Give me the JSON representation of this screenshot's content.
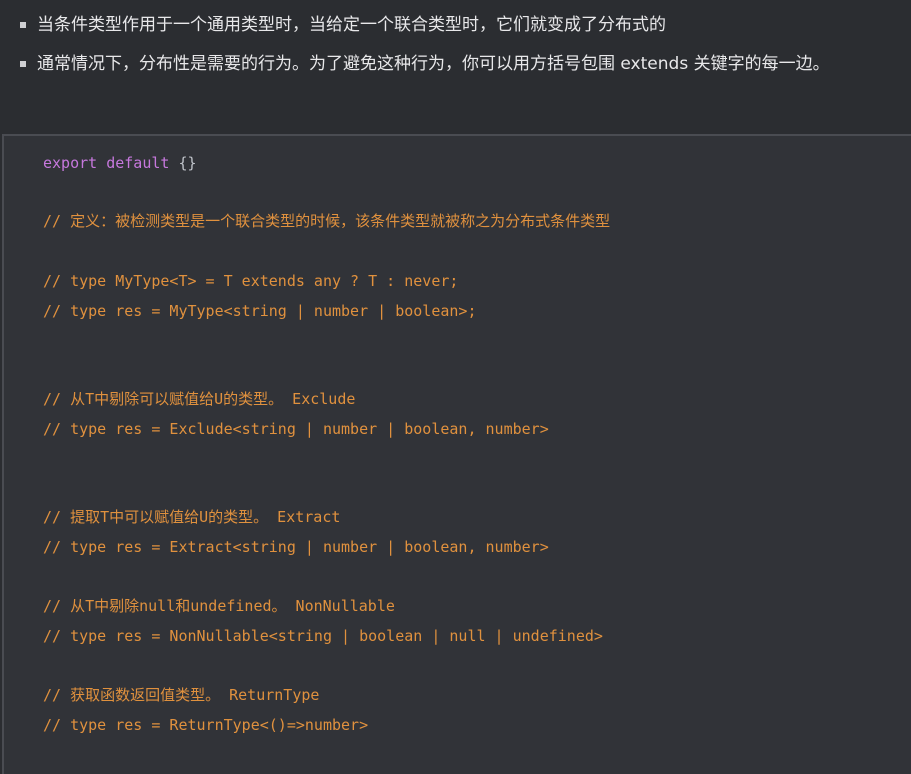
{
  "bullets": [
    {
      "text": "当条件类型作用于一个通用类型时，当给定一个联合类型时，它们就变成了分布式的"
    },
    {
      "text": "通常情况下，分布性是需要的行为。为了避免这种行为，你可以用方括号包围 extends 关键字的每一边。"
    }
  ],
  "code": {
    "export_keyword": "export default",
    "export_rest": " {}",
    "comments": [
      "// 定义：被检测类型是一个联合类型的时候，该条件类型就被称之为分布式条件类型",
      "// type MyType<T> = T extends any ? T : never;",
      "// type res = MyType<string | number | boolean>;",
      "// 从T中剔除可以赋值给U的类型。 Exclude",
      "// type res = Exclude<string | number | boolean, number>",
      "// 提取T中可以赋值给U的类型。 Extract",
      "// type res = Extract<string | number | boolean, number>",
      "// 从T中剔除null和undefined。 NonNullable",
      "// type res = NonNullable<string | boolean | null | undefined>",
      "// 获取函数返回值类型。 ReturnType",
      "// type res = ReturnType<()=>number>"
    ]
  }
}
